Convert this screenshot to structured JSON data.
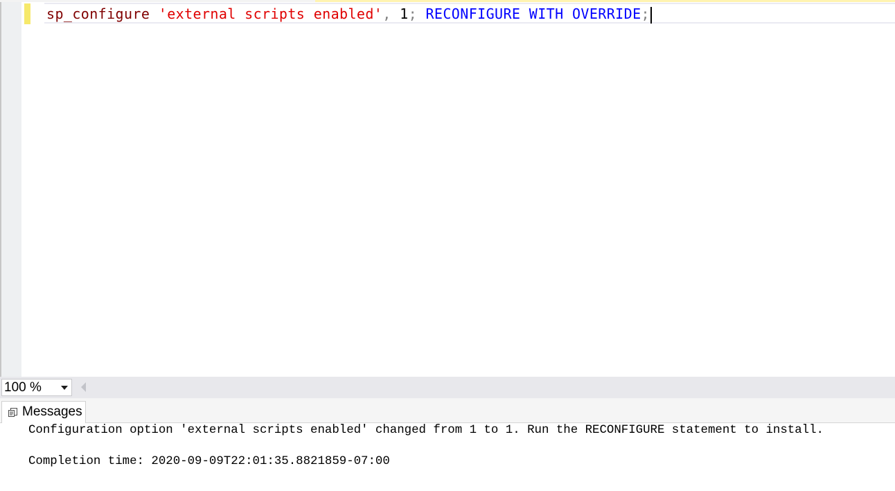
{
  "editor": {
    "tokens": {
      "fn": "sp_configure",
      "space1": " ",
      "str": "'external scripts enabled'",
      "comma": ",",
      "space2": " ",
      "num": "1",
      "semi1": ";",
      "space3": " ",
      "kw": "RECONFIGURE WITH OVERRIDE",
      "semi2": ";"
    }
  },
  "statusbar": {
    "zoom": "100 %"
  },
  "results": {
    "tab_label": "Messages",
    "lines": [
      "Configuration option 'external scripts enabled' changed from 1 to 1. Run the RECONFIGURE statement to install.",
      "Completion time: 2020-09-09T22:01:35.8821859-07:00"
    ]
  },
  "colors": {
    "function": "#800000",
    "string": "#e00000",
    "keyword": "#0000ff",
    "punctuation": "#808080",
    "change_bar": "#f6e96b"
  },
  "icons": {
    "messages_tab": "messages-icon",
    "zoom_dropdown": "chevron-down-icon",
    "scroll_left": "scroll-left-arrow-icon"
  }
}
